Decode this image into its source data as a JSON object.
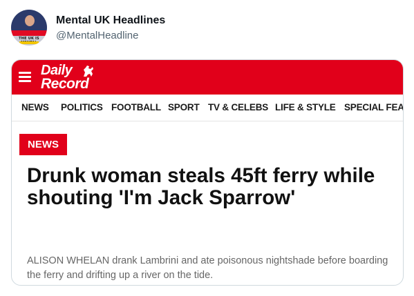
{
  "tweet": {
    "display_name": "Mental UK Headlines",
    "handle": "@MentalHeadline",
    "avatar_caption": "THE UK IS MENTAL"
  },
  "site": {
    "brand_line1": "Daily",
    "brand_line2": "Record",
    "brand_color": "#e1001a"
  },
  "nav": {
    "items": [
      "NEWS",
      "POLITICS",
      "FOOTBALL",
      "SPORT",
      "TV & CELEBS",
      "LIFE & STYLE",
      "SPECIAL FEAT"
    ]
  },
  "article": {
    "section_tag": "NEWS",
    "headline": "Drunk woman steals 45ft ferry while shouting 'I'm Jack Sparrow'",
    "standfirst": "ALISON WHELAN drank Lambrini and ate poisonous nightshade before boarding the ferry and drifting up a river on the tide."
  }
}
